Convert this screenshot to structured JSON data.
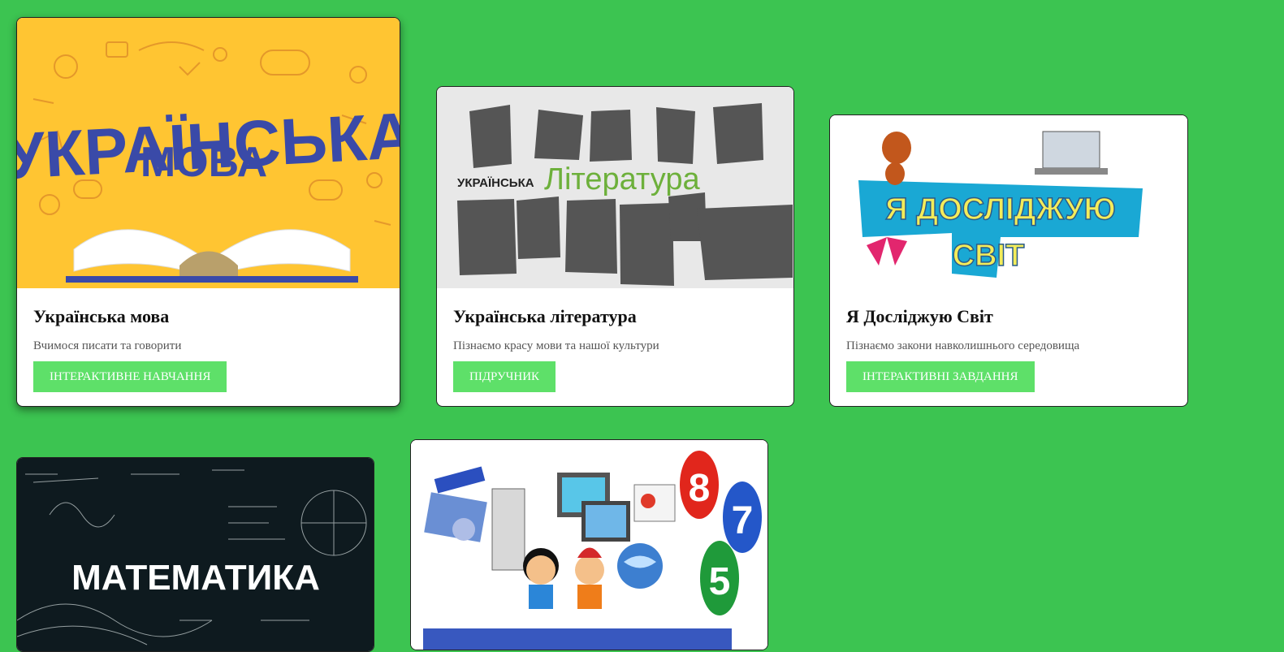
{
  "colors": {
    "page_bg": "#3cc451",
    "button_bg": "#5ee069",
    "card_bg": "#ffffff"
  },
  "cards": [
    {
      "title": "Українська мова",
      "description": "Вчимося писати та говорити",
      "button": "ІНТЕРАКТИВНЕ НАВЧАННЯ",
      "image_text": [
        "УКРАЇНСЬКА",
        "МОВА"
      ],
      "image_icon": "open-book-doodles"
    },
    {
      "title": "Українська література",
      "description": "Пізнаємо красу мови та нашої культури",
      "button": "ПІДРУЧНИК",
      "image_text": [
        "УКРАЇНСЬКА",
        "Література"
      ],
      "image_icon": "writers-portraits"
    },
    {
      "title": "Я Досліджую Світ",
      "description": "Пізнаємо закони навколишнього середовища",
      "button": "ІНТЕРАКТИВНІ ЗАВДАННЯ",
      "image_text": [
        "Я ДОСЛІДЖУЮ",
        "СВІТ"
      ],
      "image_icon": "ant-and-laptop"
    },
    {
      "image_text": [
        "МАТЕМАТИКА"
      ],
      "image_icon": "chalkboard-formulas"
    },
    {
      "image_text": [
        "8",
        "7",
        "5"
      ],
      "image_icon": "computer-kids-balloons"
    }
  ]
}
